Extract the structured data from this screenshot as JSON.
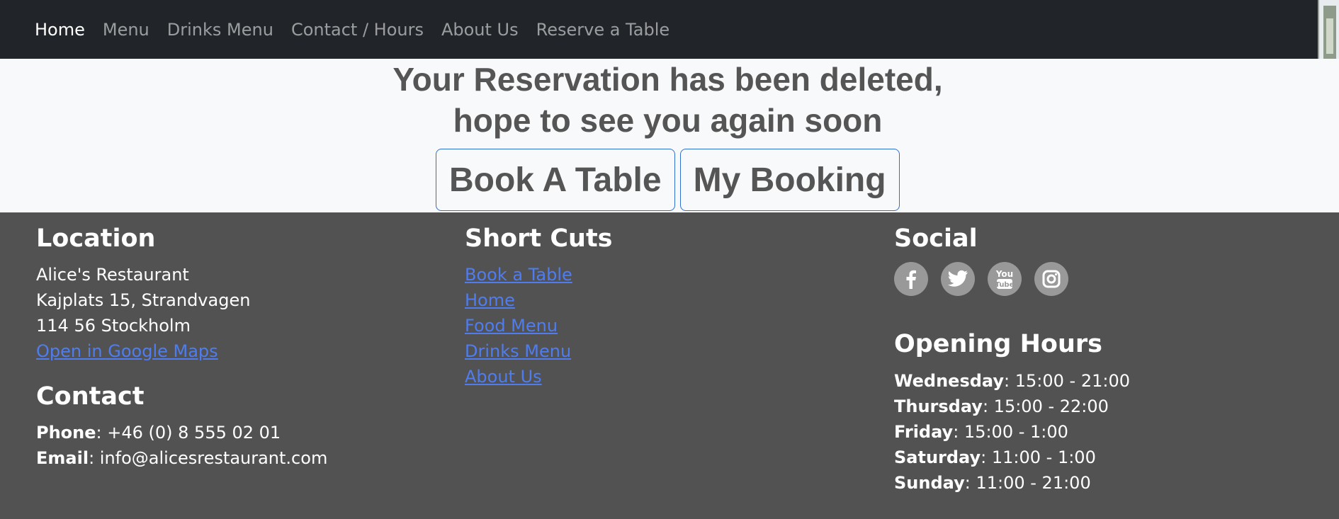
{
  "nav": {
    "items": [
      "Home",
      "Menu",
      "Drinks Menu",
      "Contact / Hours",
      "About Us",
      "Reserve a Table"
    ],
    "active": "Home"
  },
  "hero": {
    "title_line1": "Your Reservation has been deleted,",
    "title_line2": "hope to see you again soon",
    "buttons": [
      "Book A Table",
      "My Booking"
    ]
  },
  "footer": {
    "location": {
      "heading": "Location",
      "name": "Alice's Restaurant",
      "street": "Kajplats 15, Strandvagen",
      "city": "114 56 Stockholm",
      "map_link": "Open in Google Maps"
    },
    "contact": {
      "heading": "Contact",
      "phone_label": "Phone",
      "phone": ": +46 (0) 8 555 02 01",
      "email_label": "Email",
      "email": ": info@alicesrestaurant.com"
    },
    "shortcuts": {
      "heading": "Short Cuts",
      "links": [
        "Book a Table",
        "Home",
        "Food Menu",
        "Drinks Menu",
        "About Us"
      ]
    },
    "social": {
      "heading": "Social",
      "icons": [
        "facebook-icon",
        "twitter-icon",
        "youtube-icon",
        "instagram-icon"
      ]
    },
    "hours": {
      "heading": "Opening Hours",
      "rows": [
        {
          "day": "Wednesday",
          "time": ": 15:00 - 21:00"
        },
        {
          "day": "Thursday",
          "time": ": 15:00 - 22:00"
        },
        {
          "day": "Friday",
          "time": ": 15:00 - 1:00"
        },
        {
          "day": "Saturday",
          "time": ": 11:00 - 1:00"
        },
        {
          "day": "Sunday",
          "time": ": 11:00 - 21:00"
        }
      ]
    }
  },
  "colors": {
    "navbar": "#212529",
    "footer": "#525252",
    "link": "#4f7df0",
    "button_border": "#2f6fd0"
  }
}
